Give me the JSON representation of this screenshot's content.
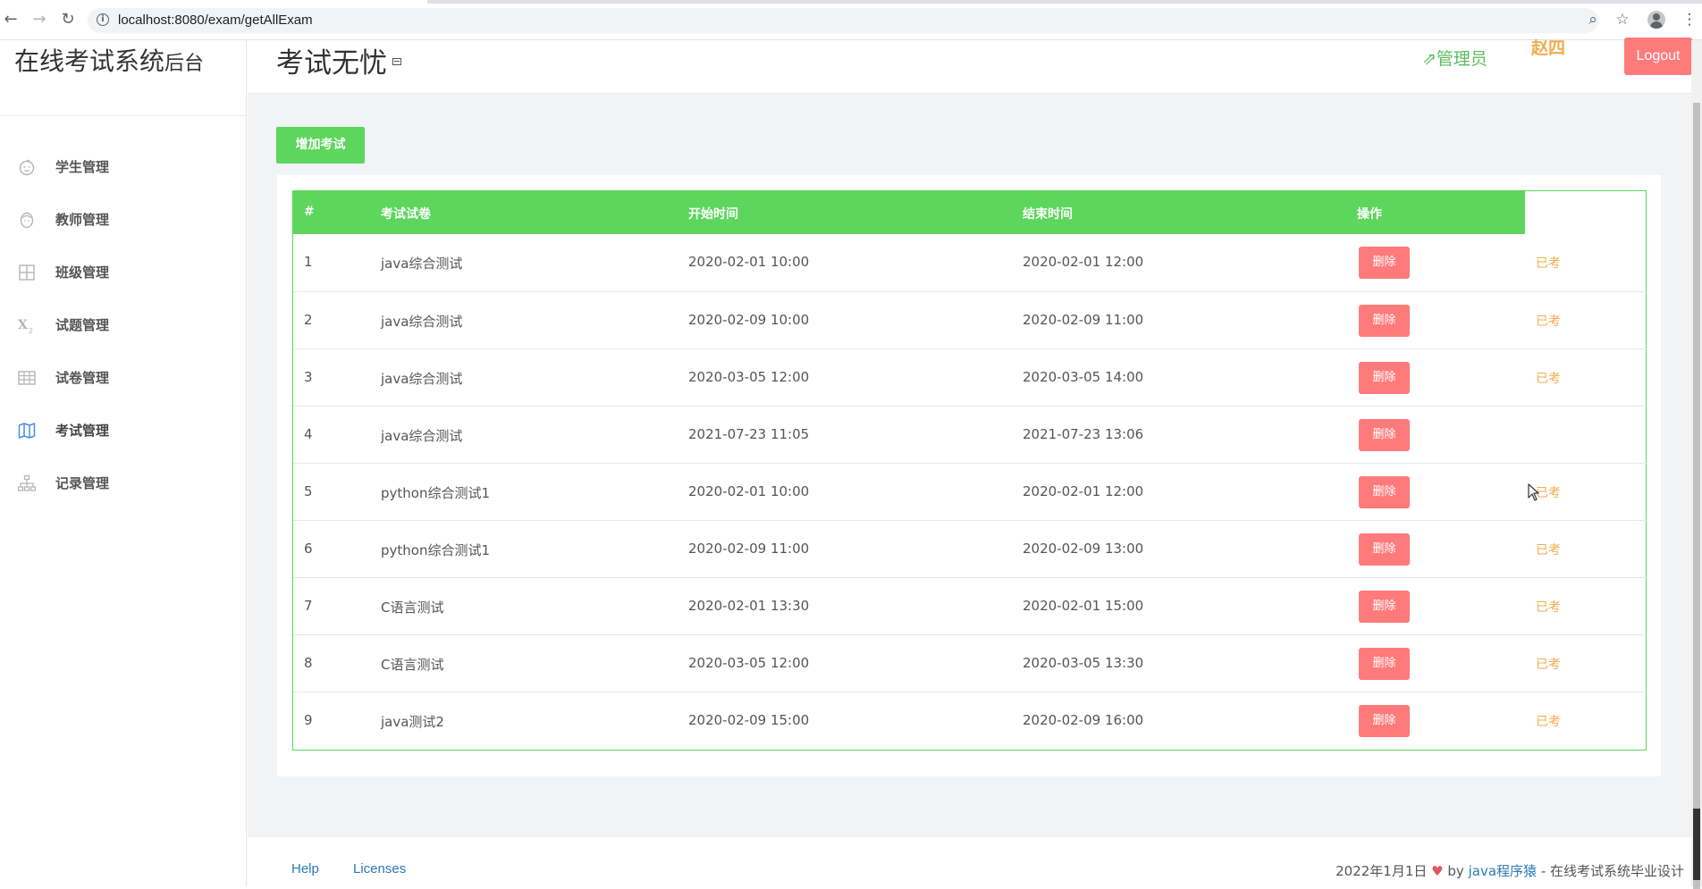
{
  "browser": {
    "url": "localhost:8080/exam/getAllExam"
  },
  "sidebar": {
    "brand_main": "在线考试系统",
    "brand_sub": "后台",
    "items": [
      {
        "label": "学生管理",
        "icon": "baby-face-icon"
      },
      {
        "label": "教师管理",
        "icon": "face-icon"
      },
      {
        "label": "班级管理",
        "icon": "grid-icon"
      },
      {
        "label": "试题管理",
        "icon": "subscript-icon"
      },
      {
        "label": "试卷管理",
        "icon": "table-icon"
      },
      {
        "label": "考试管理",
        "icon": "map-icon"
      },
      {
        "label": "记录管理",
        "icon": "sitemap-icon"
      }
    ],
    "active_item": "考试管理"
  },
  "header": {
    "title": "考试无忧",
    "role": "管理员",
    "user": "赵四",
    "logout": "Logout"
  },
  "toolbar": {
    "add_exam": "增加考试"
  },
  "table": {
    "headers": [
      "#",
      "考试试卷",
      "开始时间",
      "结束时间",
      "操作"
    ],
    "delete_label": "删除",
    "rows": [
      {
        "id": "1",
        "paper": "java综合测试",
        "start": "2020-02-01 10:00",
        "end": "2020-02-01 12:00",
        "status": "已考"
      },
      {
        "id": "2",
        "paper": "java综合测试",
        "start": "2020-02-09 10:00",
        "end": "2020-02-09 11:00",
        "status": "已考"
      },
      {
        "id": "3",
        "paper": "java综合测试",
        "start": "2020-03-05 12:00",
        "end": "2020-03-05 14:00",
        "status": "已考"
      },
      {
        "id": "4",
        "paper": "java综合测试",
        "start": "2021-07-23 11:05",
        "end": "2021-07-23 13:06",
        "status": ""
      },
      {
        "id": "5",
        "paper": "python综合测试1",
        "start": "2020-02-01 10:00",
        "end": "2020-02-01 12:00",
        "status": "已考"
      },
      {
        "id": "6",
        "paper": "python综合测试1",
        "start": "2020-02-09 11:00",
        "end": "2020-02-09 13:00",
        "status": "已考"
      },
      {
        "id": "7",
        "paper": "C语言测试",
        "start": "2020-02-01 13:30",
        "end": "2020-02-01 15:00",
        "status": "已考"
      },
      {
        "id": "8",
        "paper": "C语言测试",
        "start": "2020-03-05 12:00",
        "end": "2020-03-05 13:30",
        "status": "已考"
      },
      {
        "id": "9",
        "paper": "java测试2",
        "start": "2020-02-09 15:00",
        "end": "2020-02-09 16:00",
        "status": "已考"
      }
    ]
  },
  "footer": {
    "help": "Help",
    "licenses": "Licenses",
    "date": "2022年1月1日",
    "heart": "♥",
    "by": "by",
    "author": "java程序猿",
    "suffix": "- 在线考试系统毕业设计"
  },
  "colors": {
    "accent_green": "#5cd65c",
    "danger": "#ff7b7b",
    "warning": "#f0ad4e",
    "link": "#2a7ab8"
  }
}
